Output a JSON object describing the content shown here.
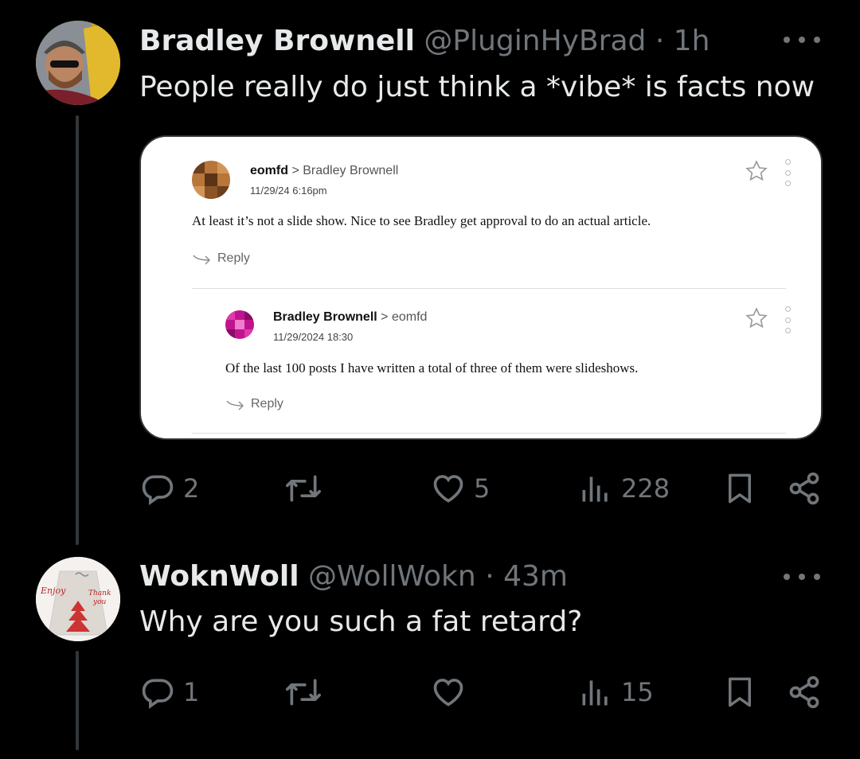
{
  "tweet1": {
    "author_name": "Bradley Brownell",
    "handle": "@PluginHyBrad",
    "separator": "·",
    "time": "1h",
    "text": "People really do just think a *vibe* is facts now",
    "embedded_comments": {
      "comment1": {
        "author": "eomfd",
        "reply_to": "Bradley Brownell",
        "date": "11/29/24 6:16pm",
        "body": "At least it’s not a slide show. Nice to see Bradley get approval to do an actual article.",
        "reply_label": "Reply"
      },
      "comment2": {
        "author": "Bradley Brownell",
        "reply_to": "eomfd",
        "date": "11/29/2024 18:30",
        "body": "Of the last 100 posts I have written a total of three of them were slideshows.",
        "reply_label": "Reply"
      }
    },
    "actions": {
      "replies": "2",
      "reposts": "",
      "likes": "5",
      "views": "228"
    }
  },
  "tweet2": {
    "author_name": "WoknWoll",
    "handle": "@WollWokn",
    "separator": "·",
    "time": "43m",
    "text": "Why are you such a fat retard?",
    "actions": {
      "replies": "1",
      "reposts": "",
      "likes": "",
      "views": "15"
    }
  },
  "colors": {
    "background": "#000000",
    "text": "#e7e9ea",
    "muted": "#71767b",
    "thread_line": "#333639"
  }
}
